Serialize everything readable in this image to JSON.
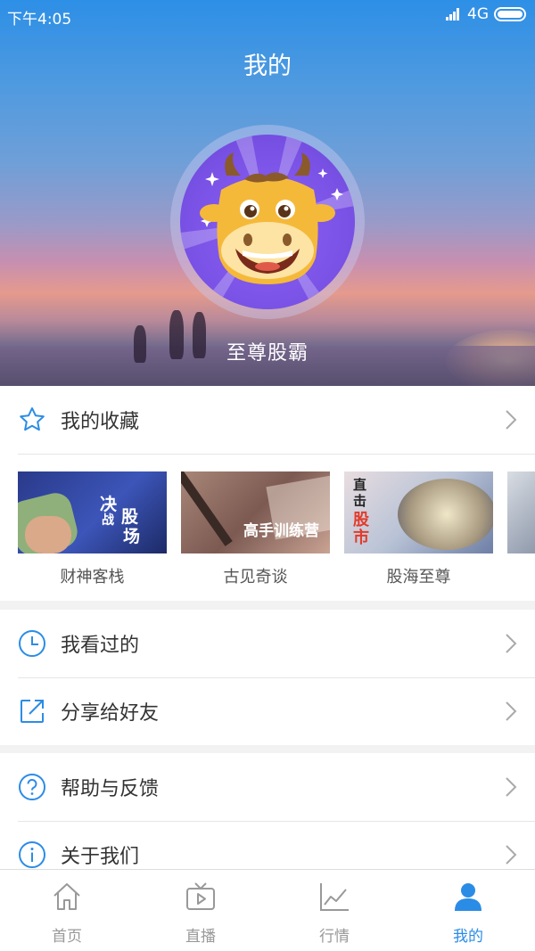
{
  "status_bar": {
    "time": "下午4:05",
    "network": "4G"
  },
  "header": {
    "title": "我的",
    "username": "至尊股霸"
  },
  "favorites": {
    "label": "我的收藏",
    "items": [
      {
        "caption": "财神客栈",
        "overlay": [
          "决",
          "战",
          "股",
          "场"
        ]
      },
      {
        "caption": "古见奇谈",
        "overlay": [
          "高手训练营"
        ]
      },
      {
        "caption": "股海至尊",
        "overlay": [
          "直",
          "击",
          "股",
          "市"
        ]
      }
    ]
  },
  "menu_group_1": [
    {
      "label": "我看过的",
      "icon": "clock-icon"
    },
    {
      "label": "分享给好友",
      "icon": "share-icon"
    }
  ],
  "menu_group_2": [
    {
      "label": "帮助与反馈",
      "icon": "help-icon"
    },
    {
      "label": "关于我们",
      "icon": "info-icon"
    }
  ],
  "tabbar": {
    "tabs": [
      {
        "label": "首页",
        "icon": "home-icon"
      },
      {
        "label": "直播",
        "icon": "tv-icon"
      },
      {
        "label": "行情",
        "icon": "chart-icon"
      },
      {
        "label": "我的",
        "icon": "user-icon",
        "active": true
      }
    ]
  },
  "colors": {
    "accent": "#2b8ce6",
    "avatar_bg": "#7a52e6",
    "mascot": "#f5b93a"
  }
}
